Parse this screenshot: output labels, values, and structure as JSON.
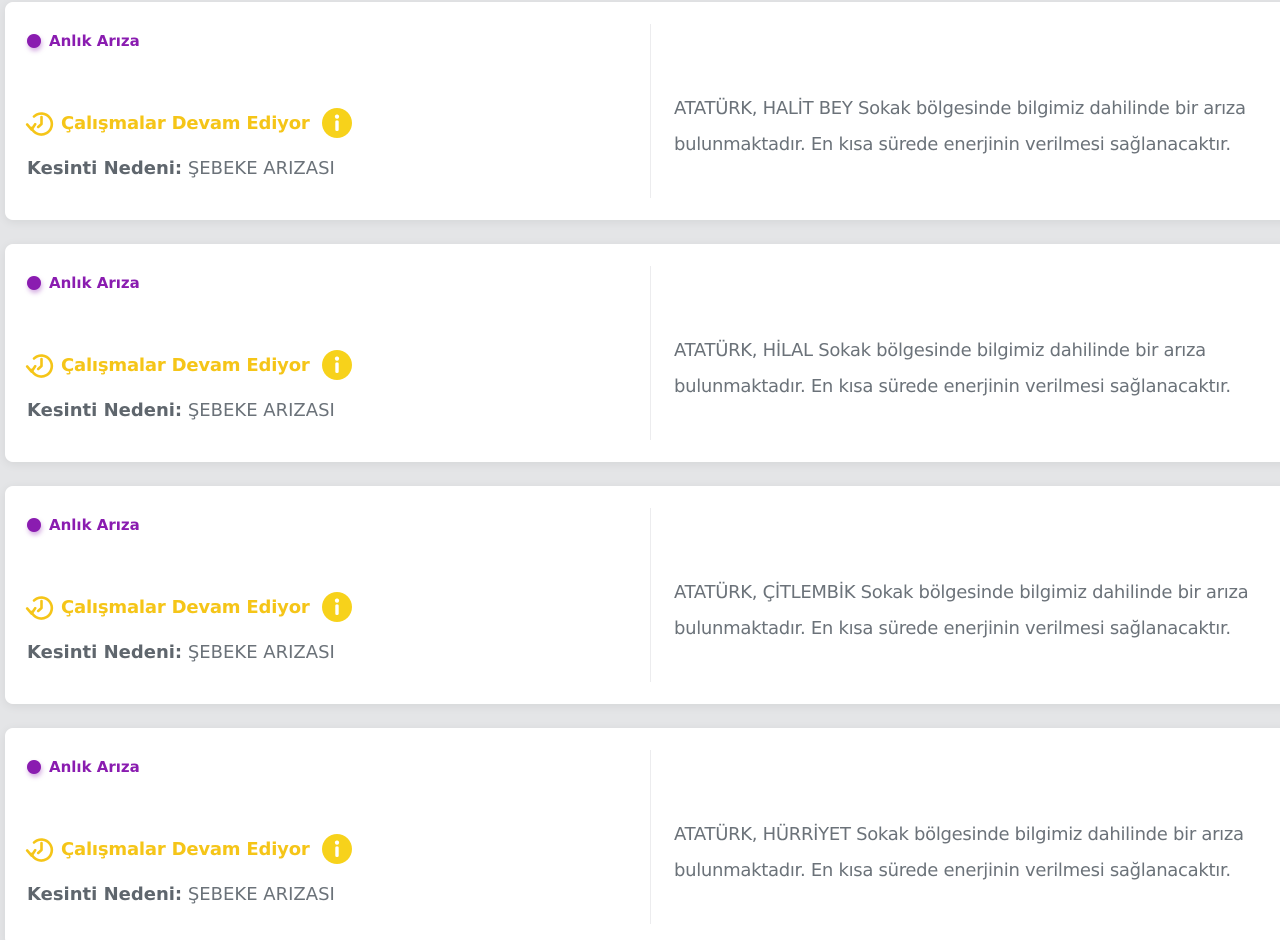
{
  "outages": [
    {
      "type_label": "Anlık Arıza",
      "status_label": "Çalışmalar Devam Ediyor",
      "reason_key": "Kesinti Nedeni:",
      "reason_value": "ŞEBEKE ARIZASI",
      "description": "ATATÜRK, HALİT BEY Sokak bölgesinde bilgimiz dahilinde bir arıza bulunmaktadır. En kısa sürede enerjinin verilmesi sağlanacaktır."
    },
    {
      "type_label": "Anlık Arıza",
      "status_label": "Çalışmalar Devam Ediyor",
      "reason_key": "Kesinti Nedeni:",
      "reason_value": "ŞEBEKE ARIZASI",
      "description": "ATATÜRK, HİLAL Sokak bölgesinde bilgimiz dahilinde bir arıza bulunmaktadır. En kısa sürede enerjinin verilmesi sağlanacaktır."
    },
    {
      "type_label": "Anlık Arıza",
      "status_label": "Çalışmalar Devam Ediyor",
      "reason_key": "Kesinti Nedeni:",
      "reason_value": "ŞEBEKE ARIZASI",
      "description": "ATATÜRK, ÇİTLEMBİK Sokak bölgesinde bilgimiz dahilinde bir arıza bulunmaktadır. En kısa sürede enerjinin verilmesi sağlanacaktır."
    },
    {
      "type_label": "Anlık Arıza",
      "status_label": "Çalışmalar Devam Ediyor",
      "reason_key": "Kesinti Nedeni:",
      "reason_value": "ŞEBEKE ARIZASI",
      "description": "ATATÜRK, HÜRRİYET Sokak bölgesinde bilgimiz dahilinde bir arıza bulunmaktadır. En kısa sürede enerjinin verilmesi sağlanacaktır."
    }
  ],
  "icons": {
    "status": "clock-arrow-icon",
    "info": "info-icon",
    "type": "status-dot"
  },
  "colors": {
    "type_accent": "#8a1cb0",
    "status_accent": "#f5c518",
    "info_badge": "#f7d21b",
    "text_muted": "#6b7279",
    "card_bg": "#ffffff",
    "page_bg": "#e4e5e7"
  }
}
